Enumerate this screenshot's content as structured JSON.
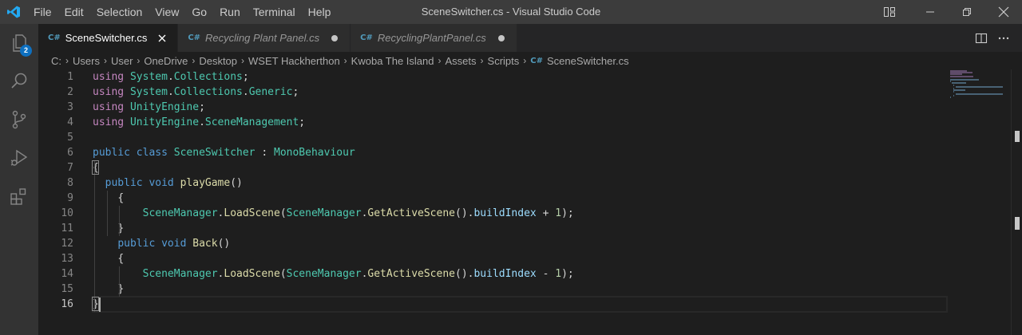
{
  "window": {
    "title": "SceneSwitcher.cs - Visual Studio Code",
    "menu": [
      "File",
      "Edit",
      "Selection",
      "View",
      "Go",
      "Run",
      "Terminal",
      "Help"
    ]
  },
  "activity_bar": {
    "explorer_badge": "2",
    "items": [
      "explorer-icon",
      "search-icon",
      "source-control-icon",
      "run-debug-icon",
      "extensions-icon"
    ]
  },
  "tabs": [
    {
      "label": "SceneSwitcher.cs",
      "active": true,
      "dirty": false
    },
    {
      "label": "Recycling Plant Panel.cs",
      "active": false,
      "dirty": true
    },
    {
      "label": "RecyclingPlantPanel.cs",
      "active": false,
      "dirty": true
    }
  ],
  "breadcrumbs": [
    "C:",
    "Users",
    "User",
    "OneDrive",
    "Desktop",
    "WSET Hackherthon",
    "Kwoba The Island",
    "Assets",
    "Scripts",
    "SceneSwitcher.cs"
  ],
  "editor": {
    "current_line": 16,
    "lines": [
      "using System.Collections;",
      "using System.Collections.Generic;",
      "using UnityEngine;",
      "using UnityEngine.SceneManagement;",
      "",
      "public class SceneSwitcher : MonoBehaviour",
      "{",
      "  public void playGame()",
      "    {",
      "        SceneManager.LoadScene(SceneManager.GetActiveScene().buildIndex + 1);",
      "    }",
      "    public void Back()",
      "    {",
      "        SceneManager.LoadScene(SceneManager.GetActiveScene().buildIndex - 1);",
      "    }",
      "}"
    ]
  },
  "colors": {
    "keyword": "#569cd6",
    "control_keyword": "#c586c0",
    "type": "#4ec9b0",
    "function": "#dcdcaa",
    "variable": "#9cdcfe",
    "number": "#b5cea8",
    "editor_bg": "#1e1e1e",
    "titlebar_bg": "#3c3c3c",
    "accent": "#0e70c0"
  }
}
